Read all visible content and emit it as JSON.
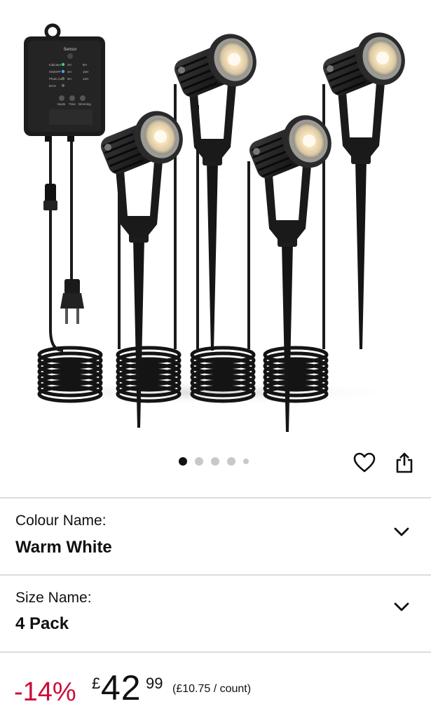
{
  "gallery": {
    "image_alt": "4 pack outdoor garden spotlights with control box and coiled cables",
    "controller_text": {
      "sensor": "Sensor",
      "rows": [
        "Indicator",
        "ON/OFF",
        "Photo Auto",
        "Error"
      ],
      "hours": [
        "2H",
        "4H",
        "6H",
        "8H",
        "10H",
        "12H"
      ],
      "buttons": [
        "Mode",
        "Time",
        "Dimming"
      ]
    },
    "page_indicator": {
      "count": 5,
      "active_index": 0
    }
  },
  "actions": {
    "wishlist_icon": "heart-icon",
    "share_icon": "share-icon"
  },
  "variations": {
    "colour": {
      "label": "Colour Name:",
      "value": "Warm White"
    },
    "size": {
      "label": "Size Name:",
      "value": "4 Pack"
    }
  },
  "price": {
    "discount": "-14%",
    "currency": "£",
    "whole": "42",
    "fraction": "99",
    "unit_price": "(£10.75 / count)",
    "discount_color": "#cc0c39"
  }
}
